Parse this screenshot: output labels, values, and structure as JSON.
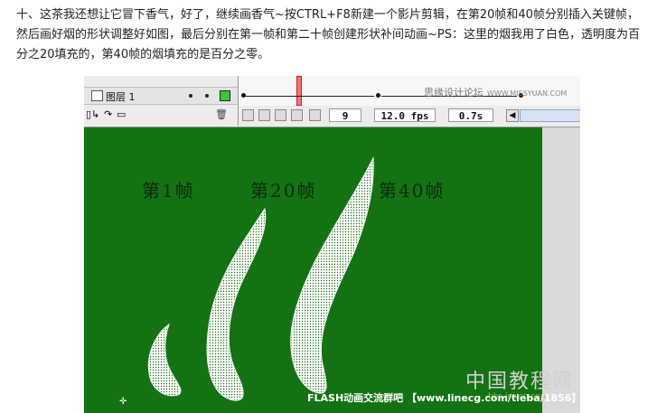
{
  "intro_text": "十、这茶我还想让它冒下香气，好了，继续画香气~按CTRL+F8新建一个影片剪辑，在第20帧和40帧分别插入关键帧，然后画好烟的形状调整好如图，最后分别在第一帧和第二十帧创建形状补间动画~PS：这里的烟我用了白色，透明度为百分之20填充的，第40帧的烟填充的是百分之零。",
  "timeline": {
    "layer_name": "图层 1",
    "layer_color": "#33cc33",
    "current_frame": "9",
    "fps": "12.0 fps",
    "elapsed": "0.7s",
    "watermark": "思缘设计论坛",
    "watermark_url": "WWW.MISSYUAN.COM"
  },
  "stage": {
    "background": "#137313",
    "labels": [
      "第1帧",
      "第20帧",
      "第40帧"
    ],
    "smoke_fill": "#ffffff"
  },
  "watermarks": {
    "bottom": "FLASH动画交流群吧 【www.linecg.com/tieba/1856】",
    "corner_title": "中国教程网",
    "corner_sub": "bbs.jcwcn.com"
  },
  "icons": [
    "layer-icon",
    "eye-dot-icon",
    "lock-dot-icon",
    "trash-icon",
    "onion-skin-icon",
    "edit-frames-icon",
    "scroll-left-icon"
  ]
}
